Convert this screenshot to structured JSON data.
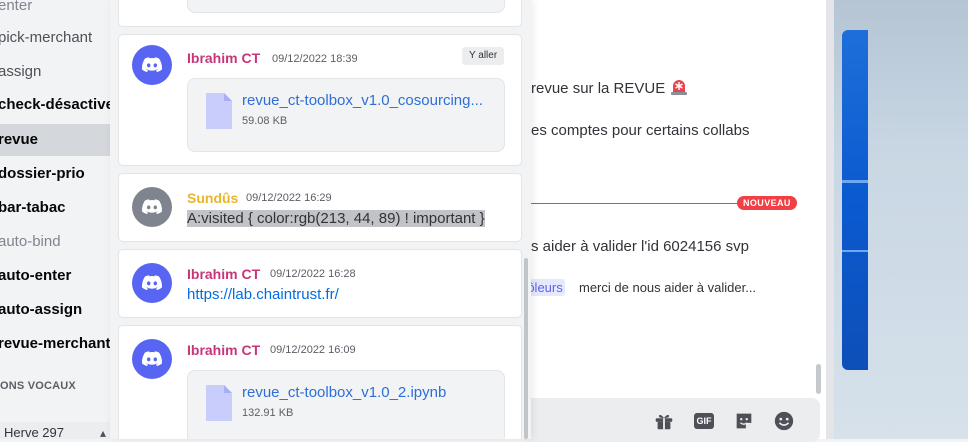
{
  "sidebar": {
    "channels": [
      {
        "label": "enter",
        "style": "muted"
      },
      {
        "label": "pick-merchant",
        "style": "normal"
      },
      {
        "label": "assign",
        "style": "normal"
      },
      {
        "label": "check-désactive",
        "style": "bold"
      },
      {
        "label": "revue",
        "style": "active"
      },
      {
        "label": "dossier-prio",
        "style": "bold"
      },
      {
        "label": "bar-tabac",
        "style": "bold"
      },
      {
        "label": "auto-bind",
        "style": "muted"
      },
      {
        "label": "auto-enter",
        "style": "bold"
      },
      {
        "label": "auto-assign",
        "style": "bold"
      },
      {
        "label": "revue-merchant",
        "style": "bold"
      }
    ],
    "voice_header": "ONS VOCAUX",
    "voice_user": "Herve 297"
  },
  "main": {
    "line1": "revue sur la REVUE",
    "line2": "es comptes pour certains collabs",
    "new_badge": "NOUVEAU",
    "line3": "s aider à valider l'id 6024156 svp",
    "mention": "rôleurs",
    "reply_text": "merci de nous aider à valider..."
  },
  "popout": {
    "jump_label": "Y aller",
    "results": [
      {
        "author": "Ibrahim CT",
        "author_color": "#c8357a",
        "timestamp": "09/12/2022 18:39",
        "avatar_color": "#5865f2",
        "file_name": "revue_ct-toolbox_v1.0_cosourcing...",
        "file_size": "59.08 KB"
      },
      {
        "author": "Sundûs",
        "author_color": "#e8b62c",
        "timestamp": "09/12/2022 16:29",
        "avatar_color": "#80848e",
        "text": "A:visited { color:rgb(213, 44, 89) ! important }"
      },
      {
        "author": "Ibrahim CT",
        "author_color": "#c8357a",
        "timestamp": "09/12/2022 16:28",
        "avatar_color": "#5865f2",
        "link": "https://lab.chaintrust.fr/"
      },
      {
        "author": "Ibrahim CT",
        "author_color": "#c8357a",
        "timestamp": "09/12/2022 16:09",
        "avatar_color": "#5865f2",
        "file_name": "revue_ct-toolbox_v1.0_2.ipynb",
        "file_size": "132.91 KB"
      }
    ]
  },
  "composer": {
    "buttons": [
      "gift-icon",
      "gif-icon",
      "sticker-icon",
      "emoji-icon"
    ],
    "gif_label": "GIF"
  }
}
